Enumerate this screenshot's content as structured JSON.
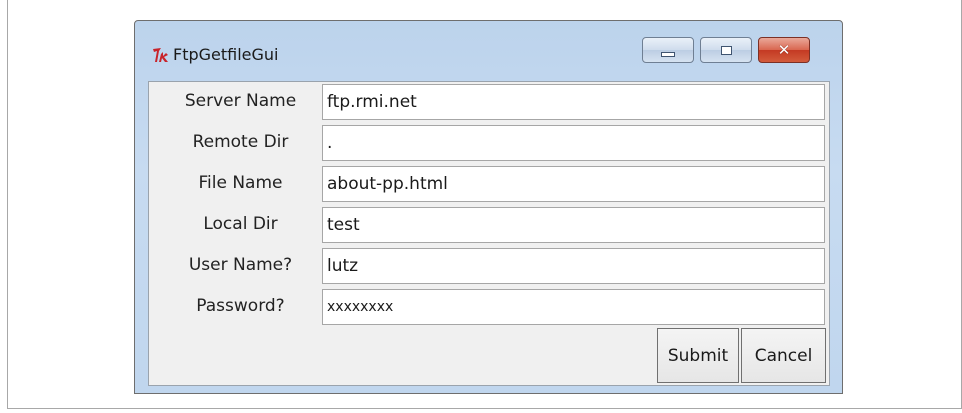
{
  "window": {
    "title": "FtpGetfileGui",
    "controls": {
      "minimize": "minimize",
      "maximize": "maximize",
      "close": "close"
    }
  },
  "form": {
    "fields": [
      {
        "label": "Server Name",
        "value": "ftp.rmi.net"
      },
      {
        "label": "Remote Dir",
        "value": "."
      },
      {
        "label": "File Name",
        "value": "about-pp.html"
      },
      {
        "label": "Local Dir",
        "value": "test"
      },
      {
        "label": "User Name?",
        "value": "lutz"
      },
      {
        "label": "Password?",
        "value": "xxxxxxxx"
      }
    ]
  },
  "buttons": {
    "submit": "Submit",
    "cancel": "Cancel"
  },
  "icons": {
    "app": "tk-feather-icon"
  },
  "colors": {
    "close_button": "#c9452c",
    "titlebar": "#c0d6ee"
  }
}
